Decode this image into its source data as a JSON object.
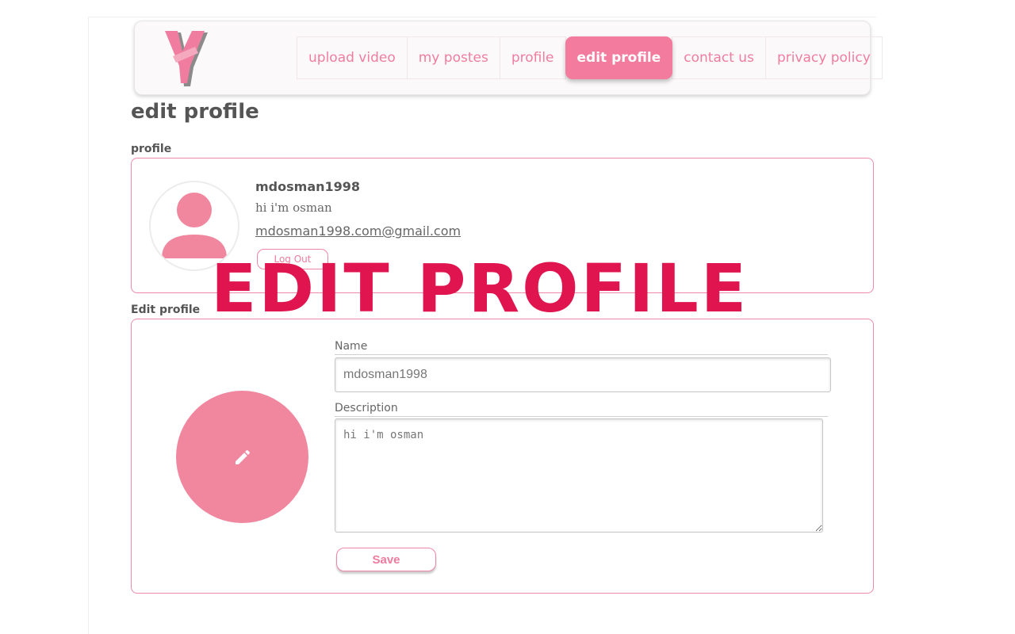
{
  "header": {
    "logo_icon": "brand-v-logo",
    "nav": [
      {
        "label": "upload video",
        "active": false
      },
      {
        "label": "my postes",
        "active": false
      },
      {
        "label": "profile",
        "active": false
      },
      {
        "label": "edit profile",
        "active": true
      },
      {
        "label": "contact us",
        "active": false
      },
      {
        "label": "privacy policy",
        "active": false
      }
    ]
  },
  "page": {
    "title": "edit profile"
  },
  "profile_section": {
    "label": "profile",
    "avatar_icon": "user-silhouette-icon",
    "username": "mdosman1998",
    "description": "hi i'm osman",
    "email": "mdosman1998.com@gmail.com",
    "logout_label": "Log Out"
  },
  "edit_section": {
    "label": "Edit profile",
    "avatar_icon": "pencil-icon",
    "name_label": "Name",
    "name_value": "mdosman1998",
    "description_label": "Description",
    "description_value": "hi i'm osman",
    "save_label": "Save"
  },
  "overlay": {
    "text": "EDIT PROFILE"
  },
  "colors": {
    "accent": "#f37b9d",
    "avatar_fill": "#f0879f",
    "overlay_text": "#e0144e",
    "card_border": "#ee8aa7"
  }
}
